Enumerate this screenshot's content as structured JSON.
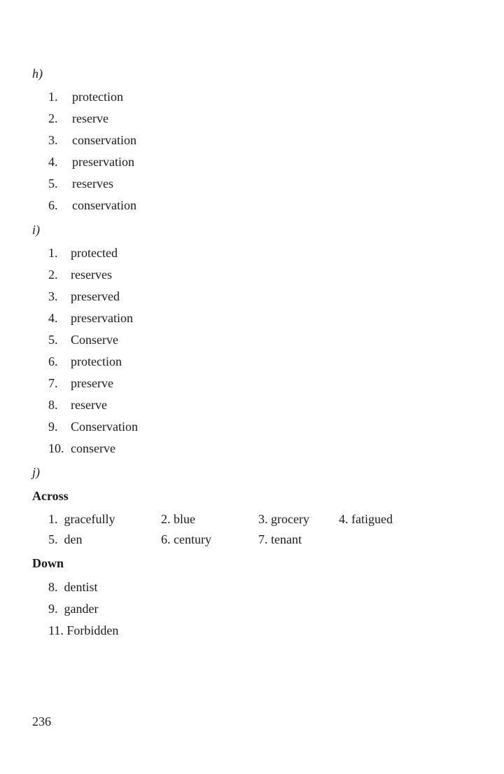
{
  "sections": {
    "h": {
      "label": "h)",
      "items": [
        {
          "num": "1.",
          "word": "protection"
        },
        {
          "num": "2.",
          "word": "reserve"
        },
        {
          "num": "3.",
          "word": "conservation"
        },
        {
          "num": "4.",
          "word": "preservation"
        },
        {
          "num": "5.",
          "word": "reserves"
        },
        {
          "num": "6.",
          "word": "conservation"
        }
      ]
    },
    "i": {
      "label": "i)",
      "items": [
        {
          "num": "1.",
          "word": "protected"
        },
        {
          "num": "2.",
          "word": "reserves"
        },
        {
          "num": "3.",
          "word": "preserved"
        },
        {
          "num": "4.",
          "word": "preservation"
        },
        {
          "num": "5.",
          "word": "Conserve"
        },
        {
          "num": "6.",
          "word": "protection"
        },
        {
          "num": "7.",
          "word": "preserve"
        },
        {
          "num": "8.",
          "word": "reserve"
        },
        {
          "num": "9.",
          "word": "Conservation"
        },
        {
          "num": "10.",
          "word": "conserve"
        }
      ]
    },
    "j": {
      "label": "j)",
      "across_heading": "Across",
      "across": [
        "1.  gracefully",
        "2. blue",
        "3. grocery",
        "4. fatigued",
        "5.  den",
        "6. century",
        "7. tenant"
      ],
      "down_heading": "Down",
      "down": [
        "8.  dentist",
        "9.  gander",
        "11. Forbidden"
      ]
    }
  },
  "page_number": "236"
}
